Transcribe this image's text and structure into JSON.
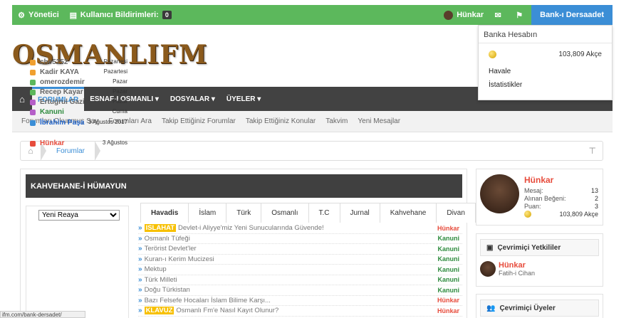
{
  "topbar": {
    "admin_label": "Yönetici",
    "reports_label": "Kullanıcı Bildirimleri:",
    "reports_count": "0",
    "username": "Hünkar",
    "bank_label": "Bank-ı Dersaadet"
  },
  "bank_dropdown": {
    "title": "Banka Hesabın",
    "amount": "103,809 Akçe",
    "link_transfer": "Havale",
    "link_stats": "İstatistikler"
  },
  "logo_text": "OSMANLIFM",
  "nav": {
    "items": [
      "FORUMLAR",
      "ESNAF-I OSMANLI ▾",
      "DOSYALAR ▾",
      "ÜYELER ▾"
    ]
  },
  "subnav": [
    "Forumları Okunmuş Say",
    "Forumları Ara",
    "Takip Ettiğiniz Forumlar",
    "Takip Ettiğiniz Konular",
    "Takvim",
    "Yeni Mesajlar"
  ],
  "breadcrumb": {
    "label": "Forumlar"
  },
  "main": {
    "title": "KAHVEHANE-İ HÜMAYUN",
    "rank_select": "Yeni Reaya",
    "activity": [
      {
        "name": "che5252",
        "time": "Pazartesi",
        "color": "#f0a030",
        "name_color": "#666666"
      },
      {
        "name": "Kadir KAYA",
        "time": "Pazartesi",
        "color": "#f0a030",
        "name_color": "#666666"
      },
      {
        "name": "omerozdemir",
        "time": "Pazar",
        "color": "#5cb85c",
        "name_color": "#666666"
      },
      {
        "name": "Recep Kayar",
        "time": "Pazar",
        "color": "#5cb85c",
        "name_color": "#666666"
      },
      {
        "name": "Ertuğrul Gazi",
        "time": "Pazar",
        "color": "#b55fc8",
        "name_color": "#666666"
      },
      {
        "name": "Kanuni",
        "time": "Cuma",
        "color": "#b55fc8",
        "name_color": "#2e8b3e"
      },
      {
        "name": "İbrahim Paşa",
        "time": "3 Ağustos 2017",
        "color": "#3b8ed6",
        "name_color": "#2266cc"
      },
      {
        "name": "Hünkar",
        "time": "3 Ağustos",
        "color": "#e74c3c",
        "name_color": "#e74c3c"
      }
    ],
    "tabs": [
      "Havadis",
      "İslam",
      "Türk",
      "Osmanlı",
      "T.C",
      "Jurnal",
      "Kahvehane",
      "Divan"
    ],
    "topics": [
      {
        "tag": "ISLAHAT",
        "title": "Devlet-i Aliyye'miz Yeni Sunucularında Güvende!",
        "author": "Hünkar",
        "author_color": "#e74c3c"
      },
      {
        "tag": "",
        "title": "Osmanlı Tüfeği",
        "author": "Kanuni",
        "author_color": "#2e8b3e"
      },
      {
        "tag": "",
        "title": "Terörist Devlet'ler",
        "author": "Kanuni",
        "author_color": "#2e8b3e"
      },
      {
        "tag": "",
        "title": "Kuran-ı Kerim Mucizesi",
        "author": "Kanuni",
        "author_color": "#2e8b3e"
      },
      {
        "tag": "",
        "title": "Mektup",
        "author": "Kanuni",
        "author_color": "#2e8b3e"
      },
      {
        "tag": "",
        "title": "Türk Milleti",
        "author": "Kanuni",
        "author_color": "#2e8b3e"
      },
      {
        "tag": "",
        "title": "Doğu Türkistan",
        "author": "Kanuni",
        "author_color": "#2e8b3e"
      },
      {
        "tag": "",
        "title": "Bazı Felsefe Hocaları İslam Bilime Karşı...",
        "author": "Hünkar",
        "author_color": "#e74c3c"
      },
      {
        "tag": "KLAVUZ",
        "title": "Osmanlı Fm'e Nasıl Kayıt Olunur?",
        "author": "Hünkar",
        "author_color": "#e74c3c"
      }
    ]
  },
  "profile": {
    "name": "Hünkar",
    "stats": [
      {
        "label": "Mesaj:",
        "value": "13"
      },
      {
        "label": "Alınan Beğeni:",
        "value": "2"
      },
      {
        "label": "Puan:",
        "value": "3"
      }
    ],
    "akce": "103,809 Akçe"
  },
  "staff_box": {
    "title": "Çevrimiçi Yetkililer",
    "name": "Hünkar",
    "role": "Fatih-i Cihan"
  },
  "online_box": {
    "title": "Çevrimiçi Üyeler"
  },
  "status_url": "ifm.com/bank-dersadet/"
}
